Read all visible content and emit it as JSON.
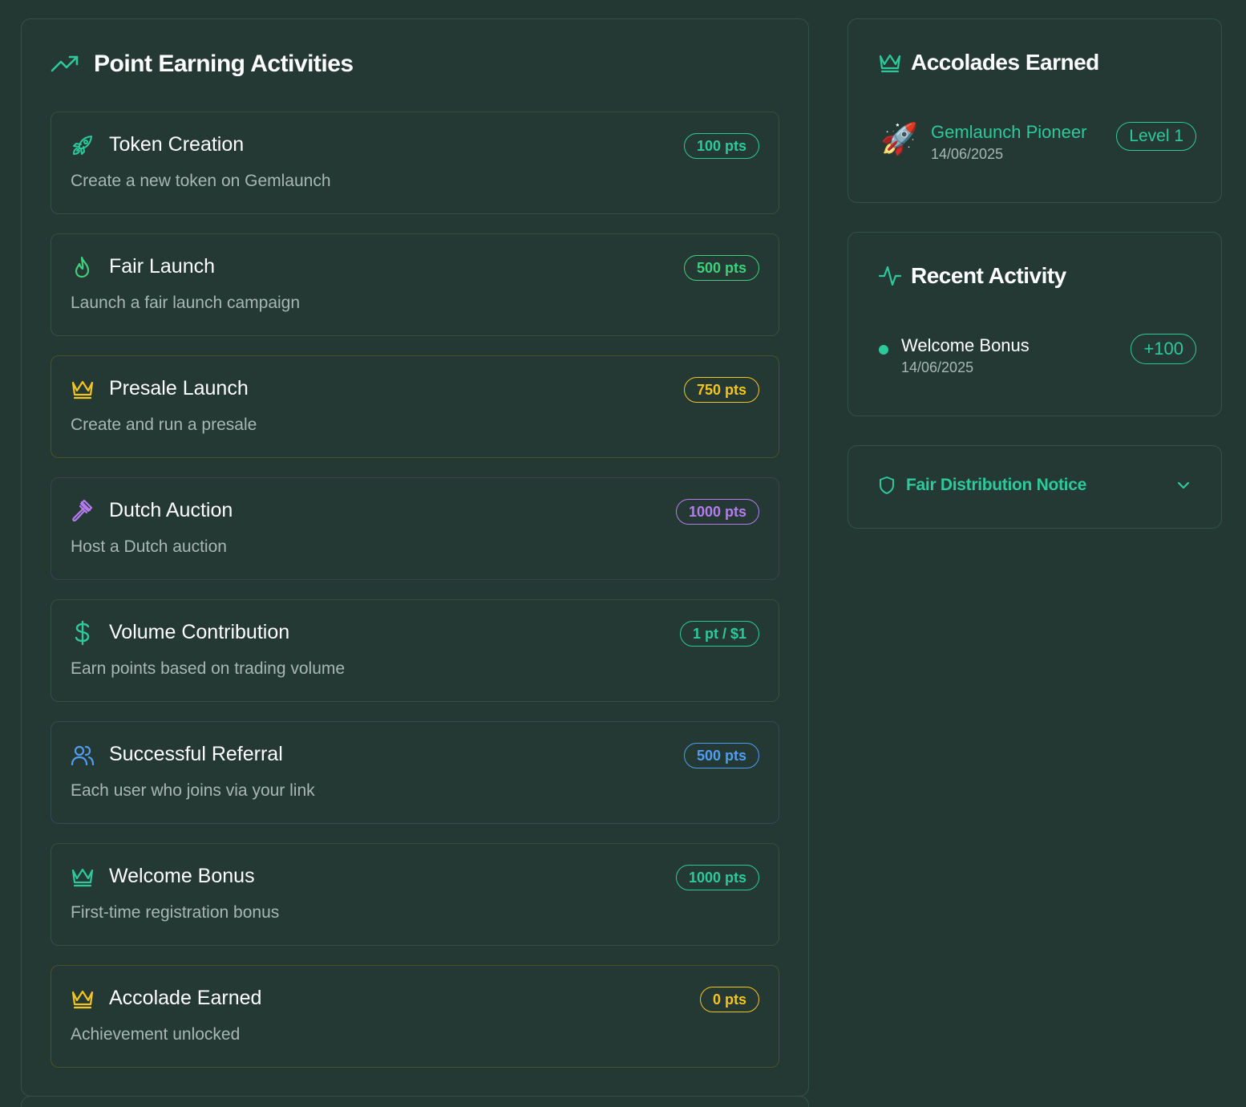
{
  "colors": {
    "background": "#243833",
    "accent_green": "#2ec99a",
    "yellow": "#f2c521",
    "purple": "#b57cf0",
    "blue": "#4f9ef0",
    "muted_text": "#a9b7b3"
  },
  "point_activities": {
    "title": "Point Earning Activities",
    "title_icon": "trending-up-icon",
    "items": [
      {
        "icon": "rocket-icon",
        "title": "Token Creation",
        "description": "Create a new token on Gemlaunch",
        "badge": "100 pts",
        "color": "#2ec99a"
      },
      {
        "icon": "flame-icon",
        "title": "Fair Launch",
        "description": "Launch a fair launch campaign",
        "badge": "500 pts",
        "color": "#3ed07a"
      },
      {
        "icon": "crown-icon",
        "title": "Presale Launch",
        "description": "Create and run a presale",
        "badge": "750 pts",
        "color": "#f2c521"
      },
      {
        "icon": "gavel-icon",
        "title": "Dutch Auction",
        "description": "Host a Dutch auction",
        "badge": "1000 pts",
        "color": "#b57cf0"
      },
      {
        "icon": "dollar-icon",
        "title": "Volume Contribution",
        "description": "Earn points based on trading volume",
        "badge": "1 pt / $1",
        "color": "#2ec99a"
      },
      {
        "icon": "users-icon",
        "title": "Successful Referral",
        "description": "Each user who joins via your link",
        "badge": "500 pts",
        "color": "#4f9ef0"
      },
      {
        "icon": "crown-icon",
        "title": "Welcome Bonus",
        "description": "First-time registration bonus",
        "badge": "1000 pts",
        "color": "#2ec99a"
      },
      {
        "icon": "crown-icon",
        "title": "Accolade Earned",
        "description": "Achievement unlocked",
        "badge": "0 pts",
        "color": "#f2c521"
      }
    ]
  },
  "accolades": {
    "title": "Accolades Earned",
    "title_icon": "crown-icon",
    "items": [
      {
        "emoji": "🚀",
        "name": "Gemlaunch Pioneer",
        "date": "14/06/2025",
        "level": "Level 1"
      }
    ]
  },
  "recent_activity": {
    "title": "Recent Activity",
    "title_icon": "activity-icon",
    "items": [
      {
        "name": "Welcome Bonus",
        "date": "14/06/2025",
        "points": "+100"
      }
    ]
  },
  "notice": {
    "title": "Fair Distribution Notice",
    "icon": "shield-icon",
    "toggle_icon": "chevron-down-icon"
  }
}
